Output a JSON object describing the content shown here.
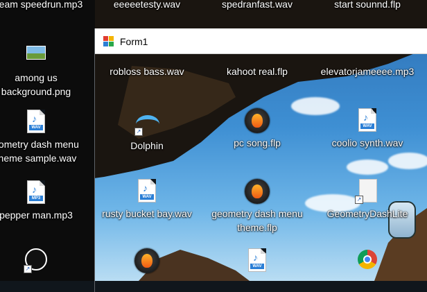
{
  "top_labels": [
    "eam speedrun.mp3",
    "eeeeetesty.wav",
    "spedranfast.wav",
    "start sounnd.flp"
  ],
  "desktop_icons": [
    {
      "label": "among us",
      "label2": "background.png",
      "kind": "image"
    },
    {
      "label": "eometry dash menu",
      "label2": "theme sample.wav",
      "kind": "wav"
    },
    {
      "label": "pepper man.mp3",
      "kind": "mp3"
    },
    {
      "label": "robloss bass.wav",
      "kind": "wav"
    },
    {
      "label": "kahoot real.flp",
      "kind": "flp"
    },
    {
      "label": "elevatorjameeee.mp3",
      "kind": "mp3"
    },
    {
      "label": "Dolphin",
      "kind": "shortcut"
    },
    {
      "label": "pc song.flp",
      "kind": "flp"
    },
    {
      "label": "coolio synth.wav",
      "kind": "wav"
    },
    {
      "label": "rusty bucket bay.wav",
      "kind": "wav"
    },
    {
      "label": "geometry dash menu",
      "label2": "theme.flp",
      "kind": "flp"
    },
    {
      "label": "GeometryDashLite",
      "kind": "shortcut"
    }
  ],
  "window": {
    "title": "Form1",
    "icon": "winforms-app-icon"
  },
  "icons_meta": {
    "wav_ext": "WAV",
    "mp3_ext": "MP3",
    "note_glyph": "♪"
  }
}
